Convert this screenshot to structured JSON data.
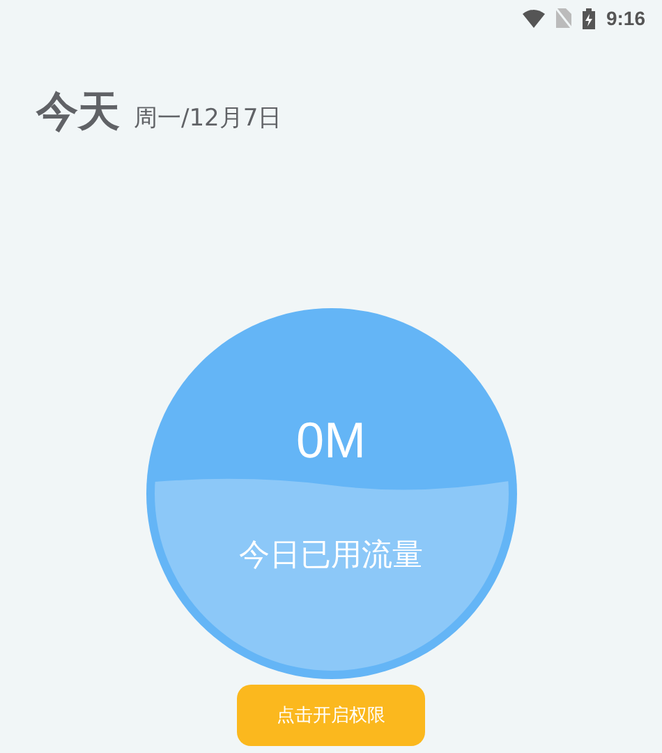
{
  "status_bar": {
    "time": "9:16"
  },
  "header": {
    "title": "今天",
    "date": "周一/12月7日"
  },
  "usage": {
    "amount": "0M",
    "label": "今日已用流量"
  },
  "button": {
    "label": "点击开启权限"
  }
}
